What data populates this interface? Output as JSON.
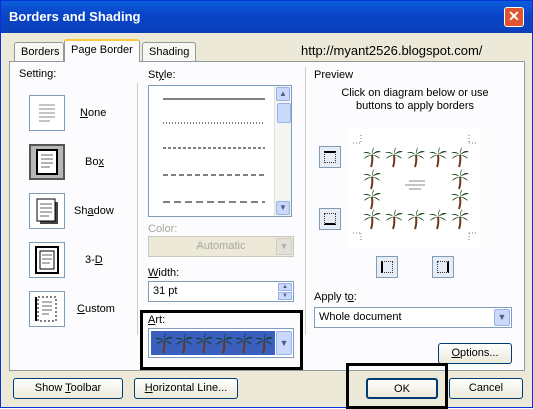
{
  "window": {
    "title": "Borders and Shading",
    "close_glyph": "✕"
  },
  "tabs": [
    {
      "label": "Borders",
      "mnemonic": "B",
      "rest": "orders"
    },
    {
      "label": "Page Border",
      "mnemonic": "P",
      "rest": "age Border"
    },
    {
      "label": "Shading",
      "mnemonic": "S",
      "rest": "hading"
    }
  ],
  "watermark": "http://myant2526.blogspot.com/",
  "setting": {
    "label": "Setting:",
    "options": [
      {
        "label": "None",
        "pre": "",
        "mn": "N",
        "post": "one"
      },
      {
        "label": "Box",
        "pre": "Bo",
        "mn": "x",
        "post": ""
      },
      {
        "label": "Shadow",
        "pre": "Sh",
        "mn": "a",
        "post": "dow"
      },
      {
        "label": "3-D",
        "pre": "3-",
        "mn": "D",
        "post": ""
      },
      {
        "label": "Custom",
        "pre": "",
        "mn": "C",
        "post": "ustom"
      }
    ],
    "selected": "Box"
  },
  "style": {
    "label": "Style:",
    "pre": "St",
    "mn": "y",
    "post": "le:"
  },
  "color": {
    "label": "Color:",
    "value": "Automatic"
  },
  "width": {
    "label": "Width:",
    "pre": "",
    "mn": "W",
    "post": "idth:",
    "value": "31 pt"
  },
  "art": {
    "label": "Art:",
    "pre": "",
    "mn": "A",
    "post": "rt:"
  },
  "preview": {
    "label": "Preview",
    "instructions": "Click on diagram below or use buttons to apply borders"
  },
  "apply_to": {
    "label": "Apply to:",
    "pre": "Apply t",
    "mn": "o",
    "post": ":",
    "value": "Whole document"
  },
  "buttons": {
    "options": {
      "label": "Options...",
      "pre": "",
      "mn": "O",
      "post": "ptions..."
    },
    "show_toolbar": {
      "label": "Show Toolbar",
      "pre": "Show ",
      "mn": "T",
      "post": "oolbar"
    },
    "horizontal_line": {
      "label": "Horizontal Line...",
      "pre": "",
      "mn": "H",
      "post": "orizontal Line..."
    },
    "ok": {
      "label": "OK"
    },
    "cancel": {
      "label": "Cancel"
    }
  },
  "colors": {
    "title_bar": "#0a4fd0",
    "highlight": "#000000",
    "art_bg": "#3a5fbf"
  },
  "icons": [
    "close-icon",
    "palm-tree-icon",
    "scroll-up-icon",
    "scroll-down-icon",
    "dropdown-arrow-icon",
    "spin-up-icon",
    "spin-down-icon",
    "border-toggle-icon"
  ]
}
